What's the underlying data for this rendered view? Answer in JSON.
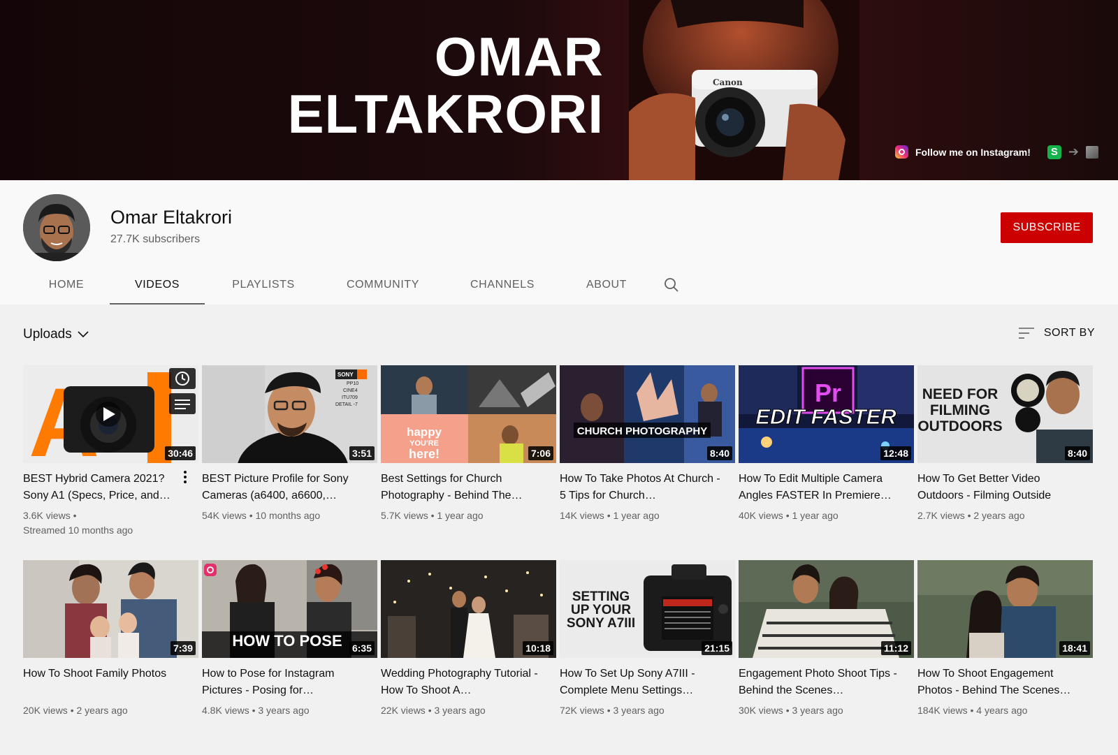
{
  "banner": {
    "name_line1": "OMAR",
    "name_line2": "ELTAKRORI",
    "link_text": "Follow me on Instagram!",
    "link_icon": "instagram-icon",
    "extra_icons": [
      "s-app-icon",
      "arrow-right-icon",
      "cube-icon"
    ]
  },
  "channel": {
    "title": "Omar Eltakrori",
    "subscribers": "27.7K subscribers",
    "subscribe_label": "SUBSCRIBE"
  },
  "tabs": [
    {
      "label": "HOME"
    },
    {
      "label": "VIDEOS",
      "active": true
    },
    {
      "label": "PLAYLISTS"
    },
    {
      "label": "COMMUNITY"
    },
    {
      "label": "CHANNELS"
    },
    {
      "label": "ABOUT"
    }
  ],
  "toolbar": {
    "uploads_label": "Uploads",
    "sort_label": "SORT BY"
  },
  "videos": [
    {
      "title": "BEST Hybrid Camera 2021? Sony A1 (Specs, Price, and…",
      "duration": "30:46",
      "meta1": "3.6K views •",
      "meta2": "Streamed 10 months ago",
      "thumb_text": "A 1"
    },
    {
      "title": "BEST Picture Profile for Sony Cameras (a6400, a6600,…",
      "duration": "3:51",
      "meta1": "54K views • 10 months ago",
      "thumb_text": "SONY PP10 CINE4 ITU709 DETAIL -7"
    },
    {
      "title": "Best Settings for Church Photography - Behind The…",
      "duration": "7:06",
      "meta1": "5.7K views • 1 year ago",
      "thumb_text": "happy YOU'RE here!"
    },
    {
      "title": "How To Take Photos At Church - 5 Tips for Church…",
      "duration": "8:40",
      "meta1": "14K views • 1 year ago",
      "thumb_text": "CHURCH PHOTOGRAPHY"
    },
    {
      "title": "How To Edit Multiple Camera Angles FASTER In Premiere…",
      "duration": "12:48",
      "meta1": "40K views • 1 year ago",
      "thumb_text": "EDIT FASTER"
    },
    {
      "title": "How To Get Better Video Outdoors - Filming Outside",
      "duration": "8:40",
      "meta1": "2.7K views • 2 years ago",
      "thumb_text": "NEED FOR FILMING OUTDOORS"
    },
    {
      "title": "How To Shoot Family Photos",
      "duration": "7:39",
      "meta1": "20K views • 2 years ago",
      "thumb_text": ""
    },
    {
      "title": "How to Pose for Instagram Pictures - Posing for…",
      "duration": "6:35",
      "meta1": "4.8K views • 3 years ago",
      "thumb_text": "HOW TO POSE"
    },
    {
      "title": "Wedding Photography Tutorial - How To Shoot A…",
      "duration": "10:18",
      "meta1": "22K views • 3 years ago",
      "thumb_text": ""
    },
    {
      "title": "How To Set Up Sony A7III - Complete Menu Settings…",
      "duration": "21:15",
      "meta1": "72K views • 3 years ago",
      "thumb_text": "SETTING UP YOUR SONY A7III"
    },
    {
      "title": "Engagement Photo Shoot Tips - Behind the Scenes…",
      "duration": "11:12",
      "meta1": "30K views • 3 years ago",
      "thumb_text": ""
    },
    {
      "title": "How To Shoot Engagement Photos - Behind The Scenes…",
      "duration": "18:41",
      "meta1": "184K views • 4 years ago",
      "thumb_text": ""
    }
  ]
}
